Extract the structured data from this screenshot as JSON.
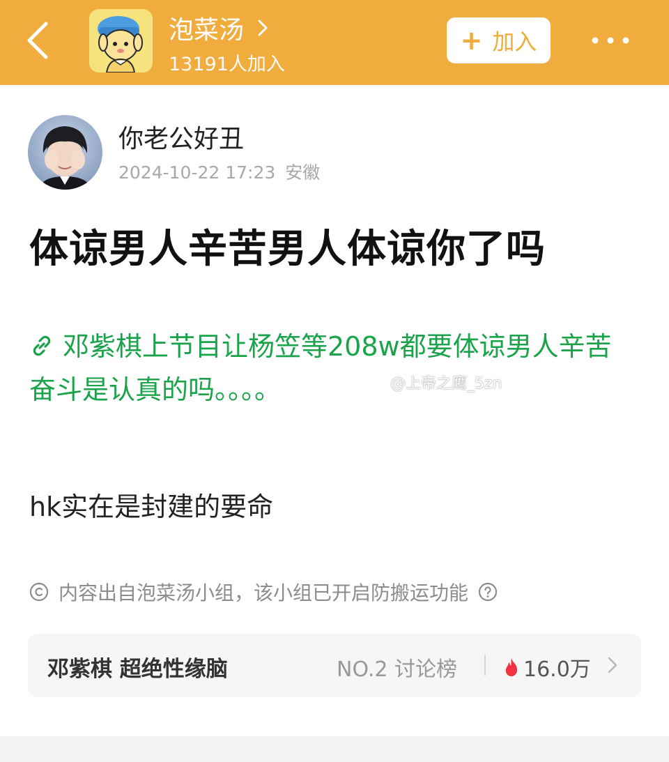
{
  "header": {
    "group_name": "泡菜汤",
    "member_count": "13191人加入",
    "join_button_label": "加入",
    "join_button_plus": "+"
  },
  "post": {
    "author_name": "你老公好丑",
    "timestamp": "2024-10-22 17:23",
    "location": "安徽",
    "title": "体谅男人辛苦男人体谅你了吗",
    "link_text": "邓紫棋上节目让杨笠等208w都要体谅男人辛苦奋斗是认真的吗。。。。",
    "body_text": "hk实在是封建的要命"
  },
  "watermark": "@上帝之鹰_5zn",
  "notice": {
    "text": "内容出自泡菜汤小组，该小组已开启防搬运功能"
  },
  "topic": {
    "name": "邓紫棋 超绝性缘脑",
    "rank": "NO.2 讨论榜",
    "heat": "16.0万"
  },
  "colors": {
    "header_bg": "#f0ac3c",
    "link_green": "#1aa34a",
    "flame_red": "#f2323f"
  }
}
